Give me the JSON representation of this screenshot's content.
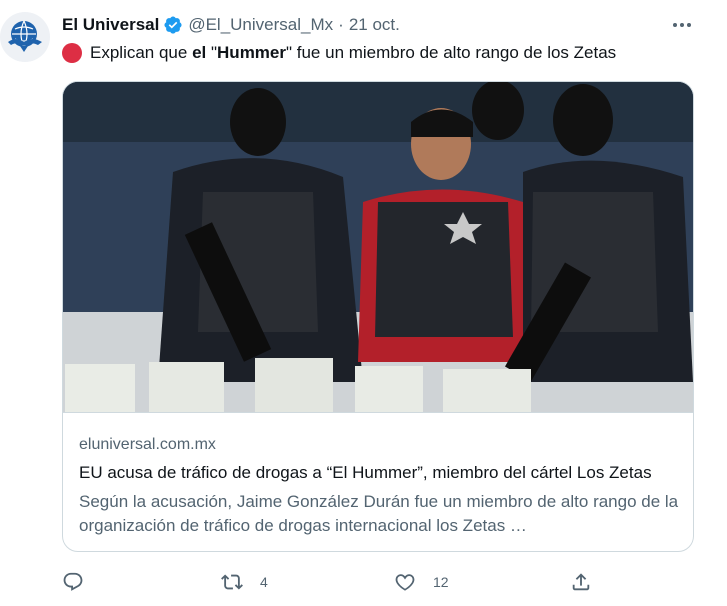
{
  "tweet": {
    "display_name": "El Universal",
    "handle": "@El_Universal_Mx",
    "separator": "·",
    "date": "21 oct.",
    "text_parts": {
      "lead": "Explican que ",
      "bold1": "el",
      "quote_open": " \"",
      "bold2": "Hummer",
      "rest": "\" fue un miembro de alto rango de los Zetas"
    },
    "icons": {
      "verified": "verified-badge-icon",
      "status_dot": "red-circle-emoji",
      "more": "more-options-icon"
    }
  },
  "card": {
    "domain": "eluniversal.com.mx",
    "title": "EU acusa de tráfico de drogas a “El Hummer”, miembro del cártel Los Zetas",
    "description": "Según la acusación, Jaime González Durán fue un miembro de alto rango de la organización de tráfico de drogas internacional los Zetas …"
  },
  "actions": {
    "reply": {
      "icon": "reply-icon",
      "count": ""
    },
    "retweet": {
      "icon": "retweet-icon",
      "count": "4"
    },
    "like": {
      "icon": "heart-icon",
      "count": "12"
    },
    "share": {
      "icon": "share-icon",
      "count": ""
    }
  },
  "colors": {
    "text": "#0f1419",
    "secondary": "#536471",
    "verified": "#1d9bf0",
    "red_dot": "#dd2e44",
    "border": "#cfd9de"
  }
}
